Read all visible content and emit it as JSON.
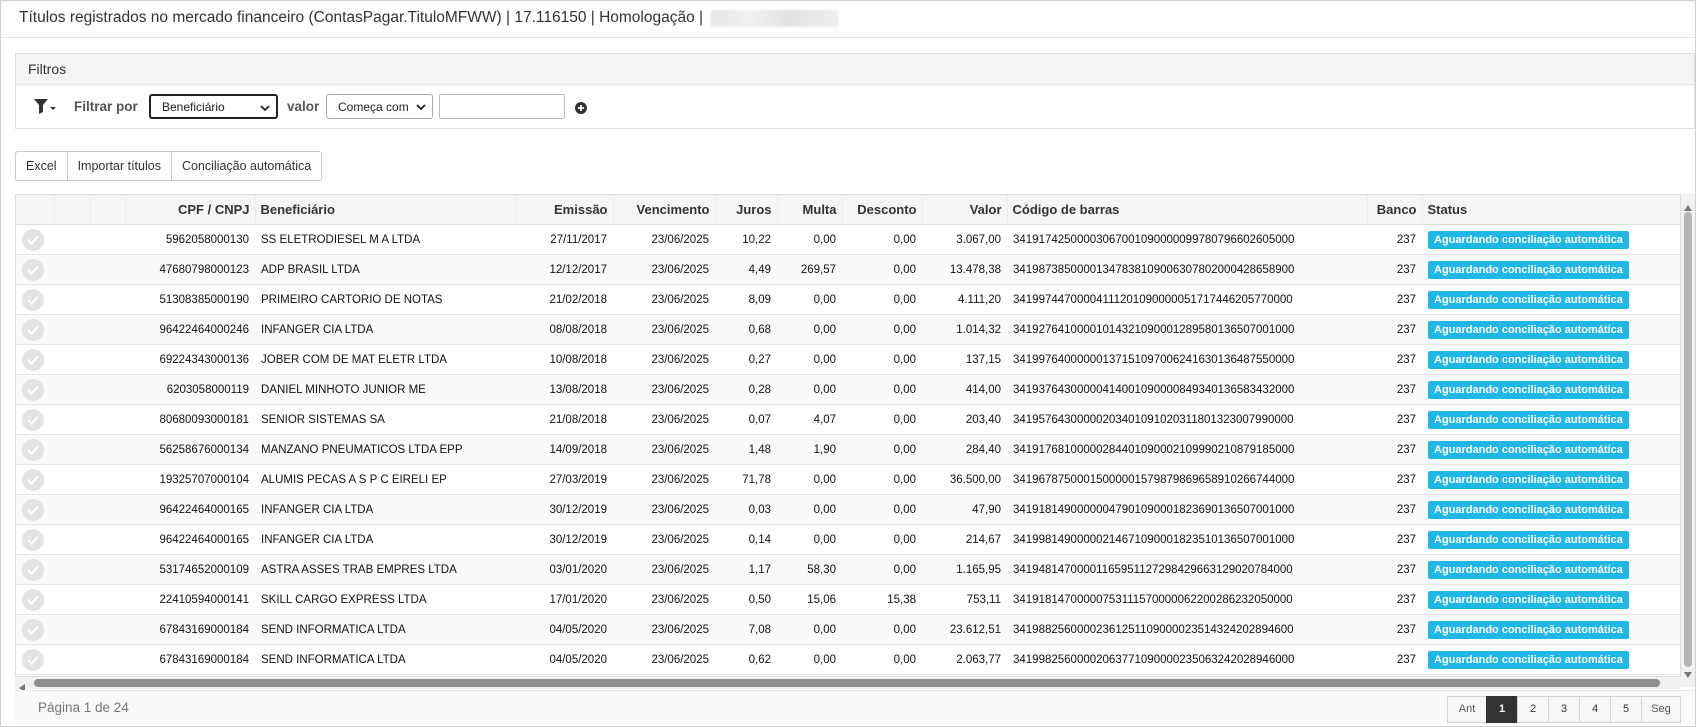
{
  "window": {
    "title": "Títulos registrados no mercado financeiro (ContasPagar.TituloMFWW) | 17.116150 | Homologação |"
  },
  "filters": {
    "heading": "Filtros",
    "filter_by_label": "Filtrar por",
    "field_selected": "Beneficiário",
    "value_label": "valor",
    "operator_selected": "Começa com",
    "value_input": ""
  },
  "toolbar": {
    "excel": "Excel",
    "import": "Importar títulos",
    "reconcile": "Conciliação automática"
  },
  "table": {
    "columns": [
      "CPF / CNPJ",
      "Beneficiário",
      "Emissão",
      "Vencimento",
      "Juros",
      "Multa",
      "Desconto",
      "Valor",
      "Código de barras",
      "Banco",
      "Status"
    ],
    "rows": [
      {
        "cnpj": "5962058000130",
        "benef": "SS ELETRODIESEL M A LTDA",
        "emissao": "27/11/2017",
        "venc": "23/06/2025",
        "juros": "10,22",
        "multa": "0,00",
        "desc": "0,00",
        "valor": "3.067,00",
        "codigo": "34191742500003067001090000099780796602605000",
        "banco": "237",
        "status": "Aguardando conciliação automática"
      },
      {
        "cnpj": "47680798000123",
        "benef": "ADP BRASIL LTDA",
        "emissao": "12/12/2017",
        "venc": "23/06/2025",
        "juros": "4,49",
        "multa": "269,57",
        "desc": "0,00",
        "valor": "13.478,38",
        "codigo": "34198738500001347838109006307802000428658900",
        "banco": "237",
        "status": "Aguardando conciliação automática"
      },
      {
        "cnpj": "51308385000190",
        "benef": "PRIMEIRO CARTORIO DE NOTAS",
        "emissao": "21/02/2018",
        "venc": "23/06/2025",
        "juros": "8,09",
        "multa": "0,00",
        "desc": "0,00",
        "valor": "4.111,20",
        "codigo": "34199744700004111201090000051717446205770000",
        "banco": "237",
        "status": "Aguardando conciliação automática"
      },
      {
        "cnpj": "96422464000246",
        "benef": "INFANGER CIA LTDA",
        "emissao": "08/08/2018",
        "venc": "23/06/2025",
        "juros": "0,68",
        "multa": "0,00",
        "desc": "0,00",
        "valor": "1.014,32",
        "codigo": "34192764100001014321090001289580136507001000",
        "banco": "237",
        "status": "Aguardando conciliação automática"
      },
      {
        "cnpj": "69224343000136",
        "benef": "JOBER COM DE MAT ELETR LTDA",
        "emissao": "10/08/2018",
        "venc": "23/06/2025",
        "juros": "0,27",
        "multa": "0,00",
        "desc": "0,00",
        "valor": "137,15",
        "codigo": "34199764000000137151097006241630136487550000",
        "banco": "237",
        "status": "Aguardando conciliação automática"
      },
      {
        "cnpj": "6203058000119",
        "benef": "DANIEL MINHOTO JUNIOR ME",
        "emissao": "13/08/2018",
        "venc": "23/06/2025",
        "juros": "0,28",
        "multa": "0,00",
        "desc": "0,00",
        "valor": "414,00",
        "codigo": "34193764300000414001090000849340136583432000",
        "banco": "237",
        "status": "Aguardando conciliação automática"
      },
      {
        "cnpj": "80680093000181",
        "benef": "SENIOR SISTEMAS SA",
        "emissao": "21/08/2018",
        "venc": "23/06/2025",
        "juros": "0,07",
        "multa": "4,07",
        "desc": "0,00",
        "valor": "203,40",
        "codigo": "34195764300000203401091020311801323007990000",
        "banco": "237",
        "status": "Aguardando conciliação automática"
      },
      {
        "cnpj": "56258676000134",
        "benef": "MANZANO PNEUMATICOS LTDA EPP",
        "emissao": "14/09/2018",
        "venc": "23/06/2025",
        "juros": "1,48",
        "multa": "1,90",
        "desc": "0,00",
        "valor": "284,40",
        "codigo": "34191768100000284401090002109990210879185000",
        "banco": "237",
        "status": "Aguardando conciliação automática"
      },
      {
        "cnpj": "19325707000104",
        "benef": "ALUMIS PECAS A S P C EIRELI EP",
        "emissao": "27/03/2019",
        "venc": "23/06/2025",
        "juros": "71,78",
        "multa": "0,00",
        "desc": "0,00",
        "valor": "36.500,00",
        "codigo": "34196787500015000001579879869658910266744000",
        "banco": "237",
        "status": "Aguardando conciliação automática"
      },
      {
        "cnpj": "96422464000165",
        "benef": "INFANGER CIA LTDA",
        "emissao": "30/12/2019",
        "venc": "23/06/2025",
        "juros": "0,03",
        "multa": "0,00",
        "desc": "0,00",
        "valor": "47,90",
        "codigo": "34191814900000047901090001823690136507001000",
        "banco": "237",
        "status": "Aguardando conciliação automática"
      },
      {
        "cnpj": "96422464000165",
        "benef": "INFANGER CIA LTDA",
        "emissao": "30/12/2019",
        "venc": "23/06/2025",
        "juros": "0,14",
        "multa": "0,00",
        "desc": "0,00",
        "valor": "214,67",
        "codigo": "34199814900000214671090001823510136507001000",
        "banco": "237",
        "status": "Aguardando conciliação automática"
      },
      {
        "cnpj": "53174652000109",
        "benef": "ASTRA ASSES TRAB EMPRES LTDA",
        "emissao": "03/01/2020",
        "venc": "23/06/2025",
        "juros": "1,17",
        "multa": "58,30",
        "desc": "0,00",
        "valor": "1.165,95",
        "codigo": "34194814700001165951127298429663129020784000",
        "banco": "237",
        "status": "Aguardando conciliação automática"
      },
      {
        "cnpj": "22410594000141",
        "benef": "SKILL CARGO EXPRESS LTDA",
        "emissao": "17/01/2020",
        "venc": "23/06/2025",
        "juros": "0,50",
        "multa": "15,06",
        "desc": "15,38",
        "valor": "753,11",
        "codigo": "34191814700000753111570000062200286232050000",
        "banco": "237",
        "status": "Aguardando conciliação automática"
      },
      {
        "cnpj": "67843169000184",
        "benef": "SEND INFORMATICA LTDA",
        "emissao": "04/05/2020",
        "venc": "23/06/2025",
        "juros": "7,08",
        "multa": "0,00",
        "desc": "0,00",
        "valor": "23.612,51",
        "codigo": "34198825600002361251109000023514324202894600",
        "banco": "237",
        "status": "Aguardando conciliação automática"
      },
      {
        "cnpj": "67843169000184",
        "benef": "SEND INFORMATICA LTDA",
        "emissao": "04/05/2020",
        "venc": "23/06/2025",
        "juros": "0,62",
        "multa": "0,00",
        "desc": "0,00",
        "valor": "2.063,77",
        "codigo": "34199825600002063771090000235063242028946000",
        "banco": "237",
        "status": "Aguardando conciliação automática"
      }
    ]
  },
  "footer": {
    "page_info": "Página 1 de 24",
    "prev": "Ant",
    "pages": [
      "1",
      "2",
      "3",
      "4",
      "5"
    ],
    "current_page": "1",
    "next": "Seg"
  },
  "colors": {
    "status_badge": "#1fb8e6",
    "active_page": "#333333"
  }
}
